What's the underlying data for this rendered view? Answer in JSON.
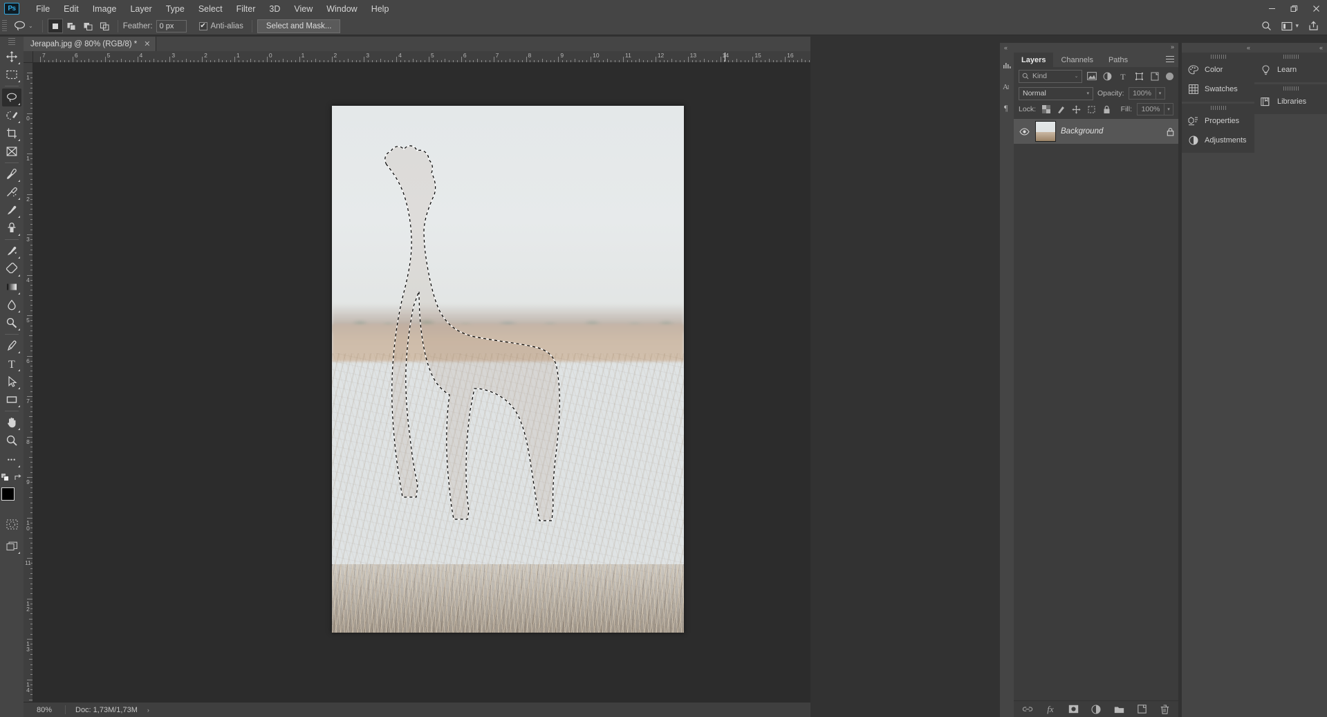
{
  "app": {
    "name": "Adobe Photoshop",
    "logo_text": "Ps"
  },
  "menubar": {
    "items": [
      {
        "label": "File"
      },
      {
        "label": "Edit"
      },
      {
        "label": "Image"
      },
      {
        "label": "Layer"
      },
      {
        "label": "Type"
      },
      {
        "label": "Select"
      },
      {
        "label": "Filter"
      },
      {
        "label": "3D"
      },
      {
        "label": "View"
      },
      {
        "label": "Window"
      },
      {
        "label": "Help"
      }
    ],
    "window_controls": {
      "minimize": "–",
      "restore": "❐",
      "close": "✕"
    }
  },
  "options_bar": {
    "tool": "lasso-tool",
    "tool_preset_caret": "⌄",
    "selection_modes": [
      {
        "name": "new-selection",
        "active": true
      },
      {
        "name": "add-to-selection",
        "active": false
      },
      {
        "name": "subtract-from-selection",
        "active": false
      },
      {
        "name": "intersect-with-selection",
        "active": false
      }
    ],
    "feather_label": "Feather:",
    "feather_value": "0 px",
    "antialias_label": "Anti-alias",
    "antialias_checked": true,
    "antialias_tick": "✔",
    "select_and_mask_label": "Select and Mask...",
    "right_icons": [
      "search-icon",
      "workspace-icon",
      "share-icon"
    ]
  },
  "document": {
    "tab_title": "Jerapah.jpg @ 80% (RGB/8) *",
    "close_glyph": "✕",
    "zoom_level": "80%",
    "doc_size": "Doc: 1,73M/1,73M",
    "status_arrow": "›"
  },
  "rulers": {
    "horizontal_labels": [
      "7",
      "6",
      "5",
      "4",
      "3",
      "2",
      "1",
      "0",
      "1",
      "2",
      "3",
      "4",
      "5",
      "6",
      "7",
      "8",
      "9",
      "10",
      "11",
      "12",
      "13",
      "14",
      "15",
      "16"
    ],
    "vertical_labels": [
      "1",
      "0",
      "1",
      "2",
      "3",
      "4",
      "5",
      "6",
      "7",
      "8",
      "9",
      "10",
      "11",
      "12",
      "13",
      "14"
    ],
    "units": "inches"
  },
  "toolbar": {
    "tools": [
      {
        "name": "move-tool",
        "active": false,
        "has_flyout": true
      },
      {
        "name": "rectangular-marquee-tool",
        "active": false,
        "has_flyout": true
      },
      {
        "name": "lasso-tool",
        "active": true,
        "has_flyout": true
      },
      {
        "name": "quick-selection-tool",
        "active": false,
        "has_flyout": true
      },
      {
        "name": "crop-tool",
        "active": false,
        "has_flyout": true
      },
      {
        "name": "frame-tool",
        "active": false,
        "has_flyout": false
      },
      {
        "name": "eyedropper-tool",
        "active": false,
        "has_flyout": true
      },
      {
        "name": "spot-healing-brush-tool",
        "active": false,
        "has_flyout": true
      },
      {
        "name": "brush-tool",
        "active": false,
        "has_flyout": true
      },
      {
        "name": "clone-stamp-tool",
        "active": false,
        "has_flyout": true
      },
      {
        "name": "history-brush-tool",
        "active": false,
        "has_flyout": true
      },
      {
        "name": "eraser-tool",
        "active": false,
        "has_flyout": true
      },
      {
        "name": "gradient-tool",
        "active": false,
        "has_flyout": true
      },
      {
        "name": "blur-tool",
        "active": false,
        "has_flyout": true
      },
      {
        "name": "dodge-tool",
        "active": false,
        "has_flyout": true
      },
      {
        "name": "pen-tool",
        "active": false,
        "has_flyout": true
      },
      {
        "name": "type-tool",
        "active": false,
        "has_flyout": true
      },
      {
        "name": "path-selection-tool",
        "active": false,
        "has_flyout": true
      },
      {
        "name": "rectangle-tool",
        "active": false,
        "has_flyout": true
      },
      {
        "name": "hand-tool",
        "active": false,
        "has_flyout": true
      },
      {
        "name": "zoom-tool",
        "active": false,
        "has_flyout": false
      }
    ],
    "more_tools_glyph": "•••",
    "foreground_color": "#000000",
    "background_color": "#ffffff",
    "bottom_items": [
      "edit-toolbar-button",
      "default-colors-icon",
      "swap-colors-icon",
      "color-swatches",
      "quick-mask-button",
      "screen-mode-button"
    ]
  },
  "canvas": {
    "background_color": "#2c2c2c",
    "selection_active": true,
    "selection_subject": "giraffe"
  },
  "layers_panel": {
    "tabs": [
      {
        "label": "Layers",
        "active": true
      },
      {
        "label": "Channels",
        "active": false
      },
      {
        "label": "Paths",
        "active": false
      }
    ],
    "menu_icon": "panel-menu-icon",
    "filter": {
      "search_icon": "search-icon",
      "kind_label": "Kind",
      "caret": "⌄",
      "type_filters": [
        "pixel-filter-icon",
        "adjustment-filter-icon",
        "type-filter-icon",
        "shape-filter-icon",
        "smart-object-filter-icon"
      ],
      "toggle_on": true
    },
    "blend_mode": "Normal",
    "opacity_label": "Opacity:",
    "opacity_value": "100%",
    "lock_label": "Lock:",
    "lock_icons": [
      "lock-transparent-pixels-icon",
      "lock-image-pixels-icon",
      "lock-position-icon",
      "lock-artboard-icon",
      "lock-all-icon"
    ],
    "fill_label": "Fill:",
    "fill_value": "100%",
    "layers": [
      {
        "name": "Background",
        "visible": true,
        "locked": true,
        "eye_icon": "eye-icon",
        "lock_icon": "lock-icon",
        "selected": true
      }
    ],
    "footer_buttons": [
      {
        "name": "link-layers-button",
        "glyph": "⚭"
      },
      {
        "name": "layer-style-button",
        "glyph": "fx"
      },
      {
        "name": "add-layer-mask-button",
        "glyph": "mask"
      },
      {
        "name": "new-adjustment-layer-button",
        "glyph": "adjust"
      },
      {
        "name": "new-group-button",
        "glyph": "folder"
      },
      {
        "name": "new-layer-button",
        "glyph": "new"
      },
      {
        "name": "delete-layer-button",
        "glyph": "trash"
      }
    ]
  },
  "right_dock": {
    "collapse_glyph": "«",
    "column_a": [
      {
        "label": "Color",
        "icon": "color-palette-icon"
      },
      {
        "label": "Swatches",
        "icon": "swatches-grid-icon"
      }
    ],
    "column_a2": [
      {
        "label": "Properties",
        "icon": "properties-icon"
      },
      {
        "label": "Adjustments",
        "icon": "adjustments-icon"
      }
    ],
    "column_b": [
      {
        "label": "Learn",
        "icon": "lightbulb-icon"
      }
    ],
    "column_b2": [
      {
        "label": "Libraries",
        "icon": "libraries-book-icon"
      }
    ]
  },
  "mini_dock": {
    "icons": [
      "histogram-icon",
      "character-icon",
      "paragraph-icon"
    ]
  }
}
